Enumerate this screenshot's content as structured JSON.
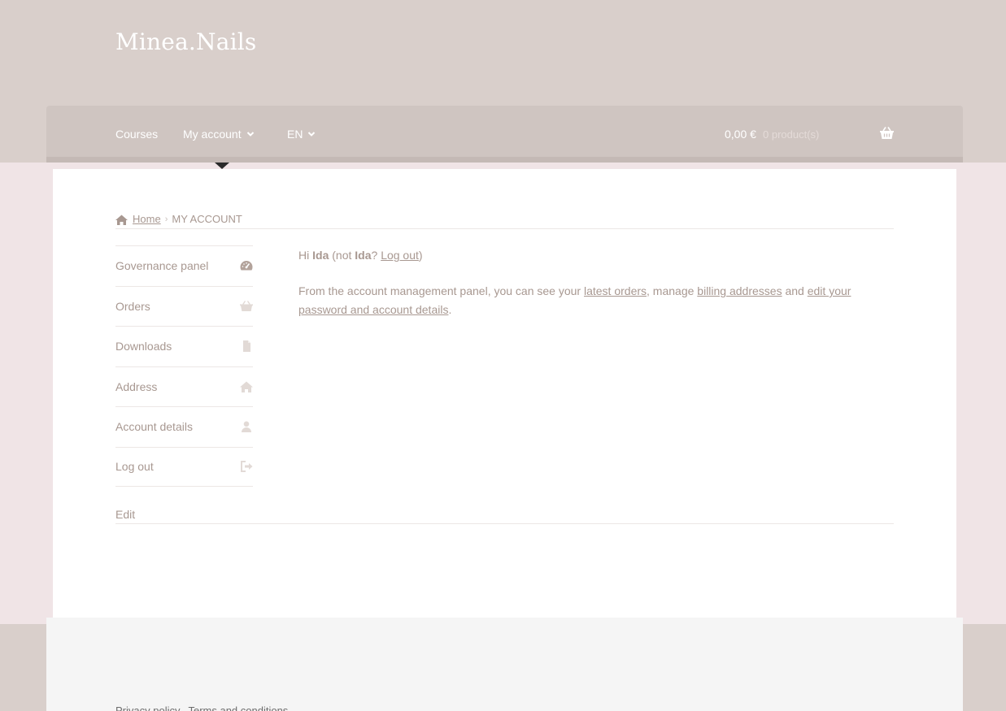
{
  "site": {
    "title": "Minea.Nails"
  },
  "nav": {
    "courses": "Courses",
    "my_account": "My account",
    "language": "EN"
  },
  "cart": {
    "total": "0,00 €",
    "count": "0 product(s)"
  },
  "breadcrumb": {
    "home": "Home",
    "separator": "›",
    "current": "MY ACCOUNT"
  },
  "account_nav": {
    "items": [
      {
        "label": "Governance panel",
        "icon": "dashboard-icon"
      },
      {
        "label": "Orders",
        "icon": "basket-icon"
      },
      {
        "label": "Downloads",
        "icon": "file-icon"
      },
      {
        "label": "Address",
        "icon": "home-icon"
      },
      {
        "label": "Account details",
        "icon": "user-icon"
      },
      {
        "label": "Log out",
        "icon": "sign-out-icon"
      }
    ]
  },
  "content": {
    "hi": "Hi",
    "user": "Ida",
    "not_prefix": "(not",
    "not_user": "Ida",
    "not_question": "?",
    "logout": "Log out",
    "close_paren": ")",
    "desc_part1": "From the account management panel, you can see your",
    "latest_orders": "latest orders",
    "desc_part2": ", manage",
    "billing_addresses": "billing addresses",
    "desc_part3": "and",
    "edit_password": "edit your password and account details",
    "desc_end": "."
  },
  "edit": {
    "label": "Edit"
  },
  "footer": {
    "link1": "Privacy policy",
    "link2": "Terms and conditions"
  },
  "colors": {
    "header": "#d9cfcb",
    "nav": "#cfc5c1",
    "body": "#f0e4e6",
    "text": "#a89891"
  }
}
